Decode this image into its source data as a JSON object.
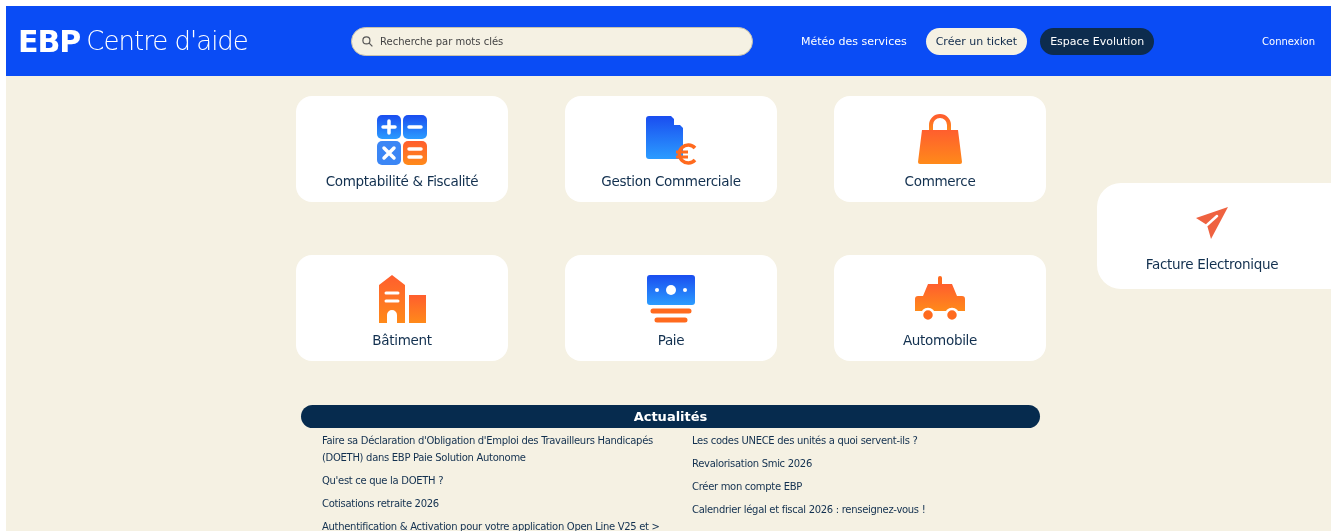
{
  "header": {
    "logo_mark": "EBP",
    "logo_text": "Centre d'aide",
    "search": {
      "placeholder": "Recherche par mots clés"
    },
    "links": [
      {
        "label": "Météo des services",
        "kind": "link"
      },
      {
        "label": "Créer un ticket",
        "kind": "light"
      },
      {
        "label": "Espace Evolution",
        "kind": "dark"
      }
    ],
    "login": "Connexion"
  },
  "categories": [
    {
      "label": "Comptabilité & Fiscalité",
      "kind": "calculator"
    },
    {
      "label": "Gestion Commerciale",
      "kind": "invoice"
    },
    {
      "label": "Commerce",
      "kind": "bag"
    },
    {
      "label": "Bâtiment",
      "kind": "building"
    },
    {
      "label": "Paie",
      "kind": "pay"
    },
    {
      "label": "Automobile",
      "kind": "car"
    }
  ],
  "featured": {
    "label": "Facture Electronique",
    "kind": "plane"
  },
  "news": {
    "title": "Actualités",
    "columns": [
      [
        "Faire sa Déclaration d'Obligation d'Emploi des Travailleurs Handicapés (DOETH) dans EBP Paie Solution Autonome",
        "Qu'est ce que la DOETH ?",
        "Cotisations retraite 2026",
        "Authentification & Activation pour votre application Open Line V25 et >"
      ],
      [
        "Les codes UNECE des unités a quoi servent-ils ?",
        "Revalorisation Smic 2026",
        "Créer mon compte EBP",
        "Calendrier légal et fiscal 2026 : renseignez-vous !"
      ]
    ]
  }
}
